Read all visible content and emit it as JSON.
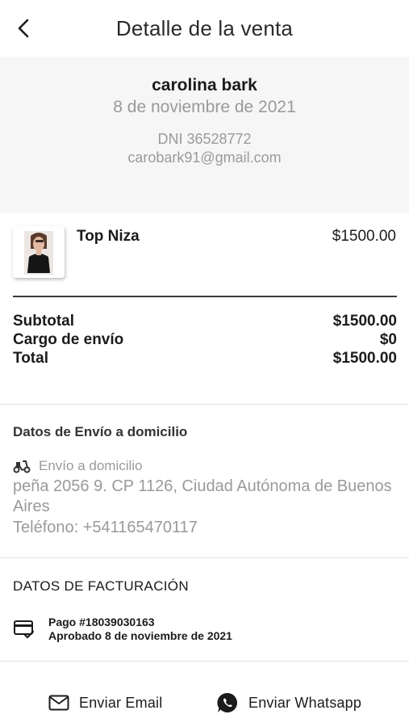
{
  "header": {
    "title": "Detalle de la venta"
  },
  "customer": {
    "name": "carolina bark",
    "date": "8 de noviembre de 2021",
    "dni": "DNI 36528772",
    "email": "carobark91@gmail.com"
  },
  "product": {
    "name": "Top Niza",
    "price": "$1500.00"
  },
  "totals": {
    "subtotal_label": "Subtotal",
    "subtotal_value": "$1500.00",
    "shipping_label": "Cargo de envío",
    "shipping_value": "$0",
    "total_label": "Total",
    "total_value": "$1500.00"
  },
  "shipping": {
    "title": "Datos de Envío a domicilio",
    "method": "Envío a domicilio",
    "address": "peña 2056 9. CP 1126, Ciudad Autónoma de Buenos Aires",
    "phone": "Teléfono: +541165470117",
    "method_icon": "scooter-icon"
  },
  "billing": {
    "title": "DATOS DE FACTURACIÓN",
    "payment_id": "Pago #18039030163",
    "status": "Aprobado 8 de noviembre de 2021",
    "icon": "credit-card-check-icon"
  },
  "actions": {
    "email_label": "Enviar Email",
    "whatsapp_label": "Enviar Whatsapp"
  },
  "colors": {
    "text": "#1b1b1b",
    "muted": "#9a9a9a",
    "panel_bg": "#f6f6f6",
    "divider": "#e3e3e3"
  }
}
